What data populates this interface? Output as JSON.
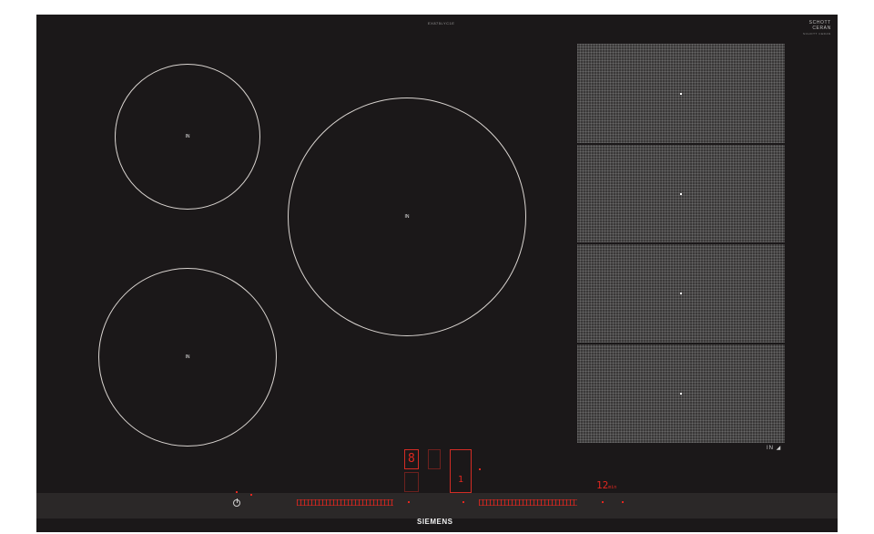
{
  "cooktop": {
    "model_code": "EX875LYC1E",
    "schott_line1": "SCHOTT",
    "schott_line2": "CERAN",
    "schott_line3": "SCHOTT CERAN"
  },
  "zones": [
    {
      "label": "IN"
    },
    {
      "label": "IN"
    },
    {
      "label": "IN"
    }
  ],
  "flex_zone": {
    "footer_label": "IN"
  },
  "controls": {
    "main_display": "8",
    "timer_display": "12",
    "timer_unit": "min",
    "boost_digit": "1",
    "brand": "SIEMENS"
  },
  "colors": {
    "surface": "#1b1819",
    "control_red": "#e2271f",
    "zone_outline": "#d9d4d0"
  }
}
